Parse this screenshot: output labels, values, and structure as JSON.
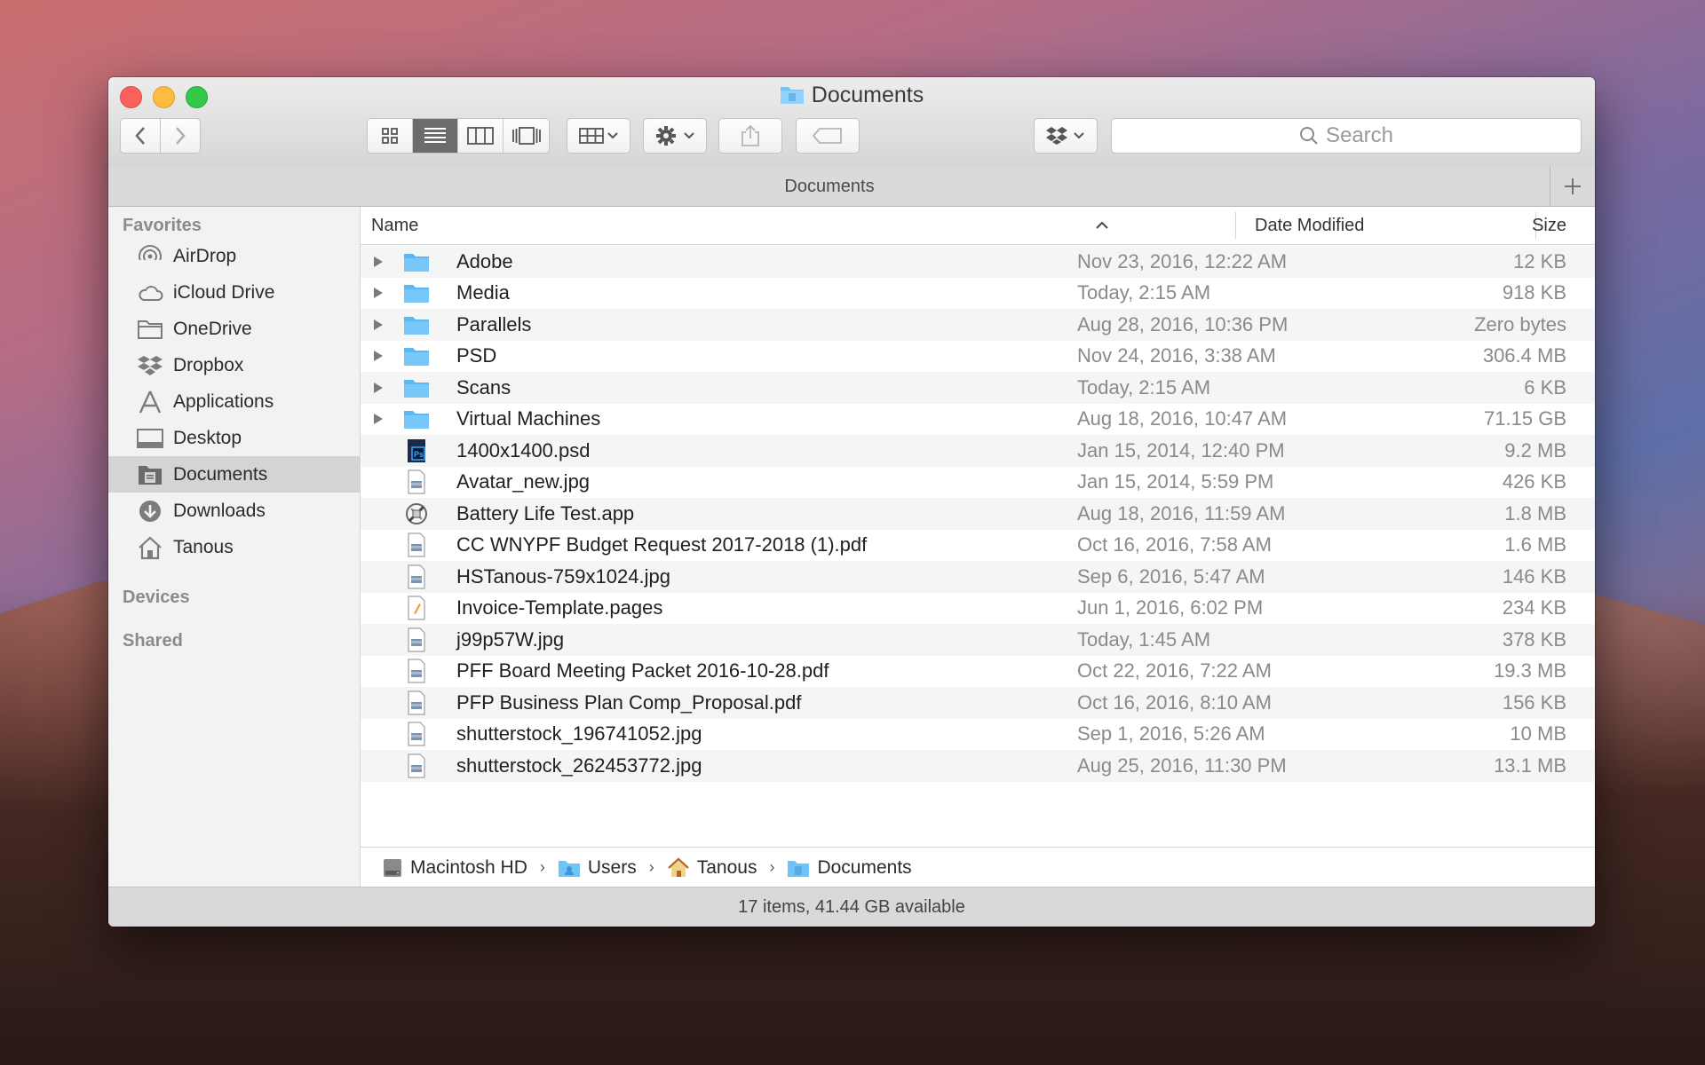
{
  "window": {
    "title": "Documents"
  },
  "tab": {
    "name": "Documents"
  },
  "search": {
    "placeholder": "Search"
  },
  "sidebar": {
    "sections": {
      "favorites": "Favorites",
      "devices": "Devices",
      "shared": "Shared"
    },
    "items": [
      {
        "label": "AirDrop",
        "icon": "airdrop-icon"
      },
      {
        "label": "iCloud Drive",
        "icon": "cloud-icon"
      },
      {
        "label": "OneDrive",
        "icon": "folder-icon"
      },
      {
        "label": "Dropbox",
        "icon": "dropbox-icon"
      },
      {
        "label": "Applications",
        "icon": "applications-icon"
      },
      {
        "label": "Desktop",
        "icon": "desktop-icon"
      },
      {
        "label": "Documents",
        "icon": "documents-icon",
        "selected": true
      },
      {
        "label": "Downloads",
        "icon": "downloads-icon"
      },
      {
        "label": "Tanous",
        "icon": "home-icon"
      }
    ]
  },
  "columns": {
    "name": "Name",
    "date": "Date Modified",
    "size": "Size"
  },
  "files": [
    {
      "name": "Adobe",
      "date": "Nov 23, 2016, 12:22 AM",
      "size": "12 KB",
      "kind": "folder"
    },
    {
      "name": "Media",
      "date": "Today, 2:15 AM",
      "size": "918 KB",
      "kind": "folder"
    },
    {
      "name": "Parallels",
      "date": "Aug 28, 2016, 10:36 PM",
      "size": "Zero bytes",
      "kind": "folder"
    },
    {
      "name": "PSD",
      "date": "Nov 24, 2016, 3:38 AM",
      "size": "306.4 MB",
      "kind": "folder"
    },
    {
      "name": "Scans",
      "date": "Today, 2:15 AM",
      "size": "6 KB",
      "kind": "folder"
    },
    {
      "name": "Virtual Machines",
      "date": "Aug 18, 2016, 10:47 AM",
      "size": "71.15 GB",
      "kind": "folder"
    },
    {
      "name": "1400x1400.psd",
      "date": "Jan 15, 2014, 12:40 PM",
      "size": "9.2 MB",
      "kind": "psd"
    },
    {
      "name": "Avatar_new.jpg",
      "date": "Jan 15, 2014, 5:59 PM",
      "size": "426 KB",
      "kind": "doc"
    },
    {
      "name": "Battery Life Test.app",
      "date": "Aug 18, 2016, 11:59 AM",
      "size": "1.8 MB",
      "kind": "app"
    },
    {
      "name": "CC WNYPF Budget Request 2017-2018 (1).pdf",
      "date": "Oct 16, 2016, 7:58 AM",
      "size": "1.6 MB",
      "kind": "doc"
    },
    {
      "name": "HSTanous-759x1024.jpg",
      "date": "Sep 6, 2016, 5:47 AM",
      "size": "146 KB",
      "kind": "doc"
    },
    {
      "name": "Invoice-Template.pages",
      "date": "Jun 1, 2016, 6:02 PM",
      "size": "234 KB",
      "kind": "pages"
    },
    {
      "name": "j99p57W.jpg",
      "date": "Today, 1:45 AM",
      "size": "378 KB",
      "kind": "doc"
    },
    {
      "name": "PFF Board Meeting Packet 2016-10-28.pdf",
      "date": "Oct 22, 2016, 7:22 AM",
      "size": "19.3 MB",
      "kind": "doc"
    },
    {
      "name": "PFP Business Plan Comp_Proposal.pdf",
      "date": "Oct 16, 2016, 8:10 AM",
      "size": "156 KB",
      "kind": "doc"
    },
    {
      "name": "shutterstock_196741052.jpg",
      "date": "Sep 1, 2016, 5:26 AM",
      "size": "10 MB",
      "kind": "doc"
    },
    {
      "name": "shutterstock_262453772.jpg",
      "date": "Aug 25, 2016, 11:30 PM",
      "size": "13.1 MB",
      "kind": "doc"
    }
  ],
  "path": [
    {
      "label": "Macintosh HD",
      "icon": "disk-icon"
    },
    {
      "label": "Users",
      "icon": "users-folder-icon"
    },
    {
      "label": "Tanous",
      "icon": "home-icon"
    },
    {
      "label": "Documents",
      "icon": "documents-folder-icon"
    }
  ],
  "status": {
    "text": "17 items, 41.44 GB available"
  },
  "colors": {
    "folder": "#5ab9f5",
    "selected_sidebar": "#d4d4d4",
    "close": "#fc605c",
    "minimize": "#fdbc40",
    "maximize": "#34c84a"
  }
}
